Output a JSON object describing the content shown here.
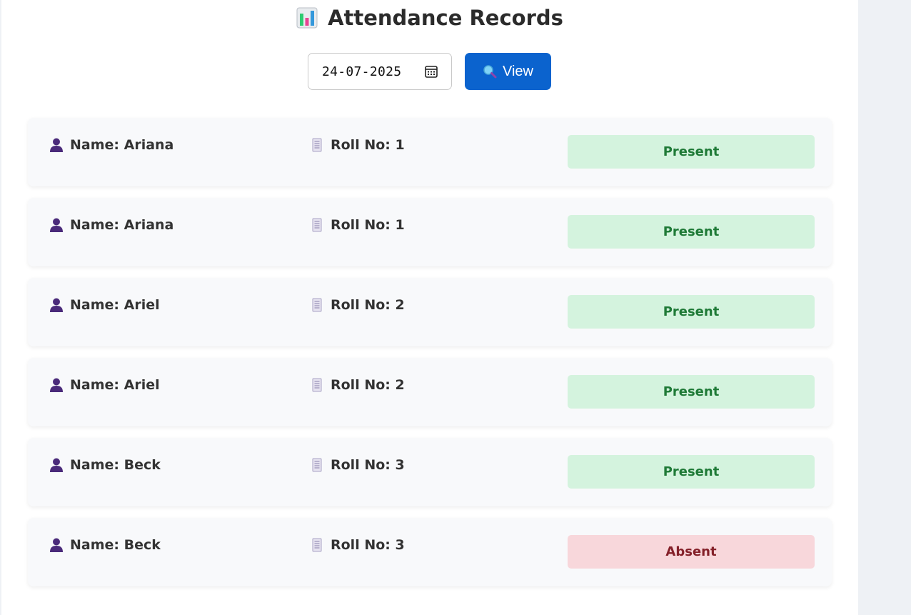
{
  "header": {
    "title": "Attendance Records",
    "title_icon": "bar-chart-icon"
  },
  "controls": {
    "date_value": "24-07-2025",
    "date_icon": "calendar-icon",
    "view_label": "View",
    "view_icon": "magnifier-icon"
  },
  "colors": {
    "accent": "#0b63ce",
    "present_bg": "#d4f3de",
    "present_text": "#1f7a37",
    "absent_bg": "#f8d7db",
    "absent_text": "#842029"
  },
  "records": [
    {
      "name": "Name: Ariana",
      "roll": "Roll No: 1",
      "status": "Present"
    },
    {
      "name": "Name: Ariana",
      "roll": "Roll No: 1",
      "status": "Present"
    },
    {
      "name": "Name: Ariel",
      "roll": "Roll No: 2",
      "status": "Present"
    },
    {
      "name": "Name: Ariel",
      "roll": "Roll No: 2",
      "status": "Present"
    },
    {
      "name": "Name: Beck",
      "roll": "Roll No: 3",
      "status": "Present"
    },
    {
      "name": "Name: Beck",
      "roll": "Roll No: 3",
      "status": "Absent"
    }
  ]
}
